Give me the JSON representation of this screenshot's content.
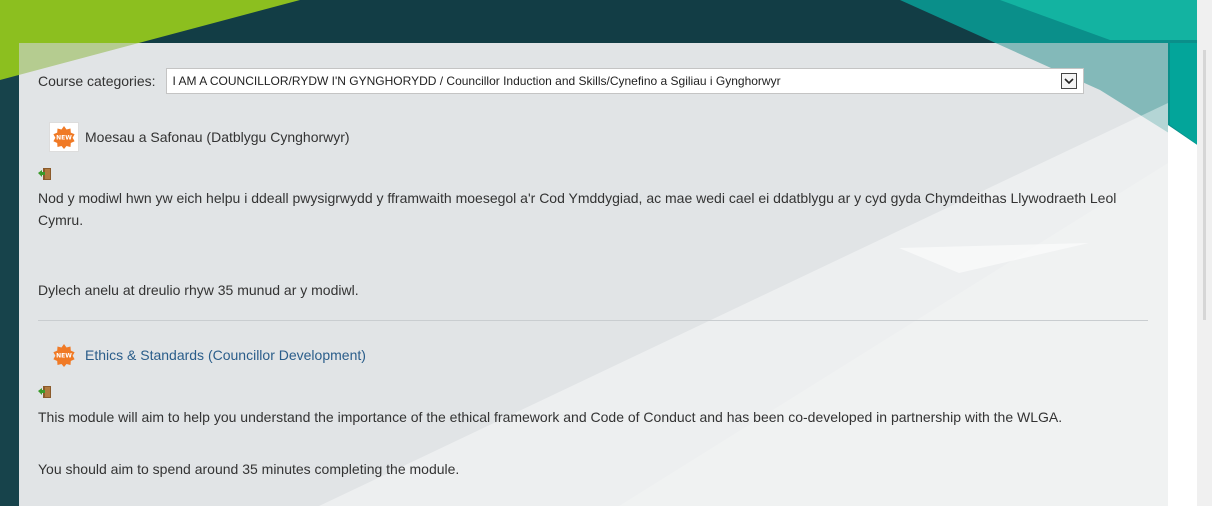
{
  "course_categories": {
    "label": "Course categories:",
    "selected": "I AM A COUNCILLOR/RYDW I'N GYNGHORYDD / Councillor Induction and Skills/Cynefino a Sgiliau i Gynghorwyr"
  },
  "courses": [
    {
      "badge": "NEW",
      "title": "Moesau a Safonau (Datblygu Cynghorwyr)",
      "paragraphs": [
        "Nod y modiwl hwn yw eich helpu i ddeall pwysigrwydd y fframwaith moesegol a'r Cod Ymddygiad, ac mae wedi cael ei ddatblygu ar y cyd gyda Chymdeithas Llywodraeth Leol Cymru.",
        "Dylech anelu at dreulio rhyw 35 munud ar y modiwl."
      ]
    },
    {
      "badge": "NEW",
      "title": "Ethics & Standards (Councillor Development)",
      "paragraphs": [
        "This module will aim to help you understand the importance of the ethical framework and Code of Conduct and has been co-developed in partnership with the WLGA.",
        "You should aim to spend around 35 minutes completing the module."
      ]
    }
  ],
  "colors": {
    "dark_teal": "#123d45",
    "lime": "#8cbf1f",
    "teal": "#00a89a",
    "link": "#2a5d8a",
    "badge_orange": "#f07a26"
  }
}
